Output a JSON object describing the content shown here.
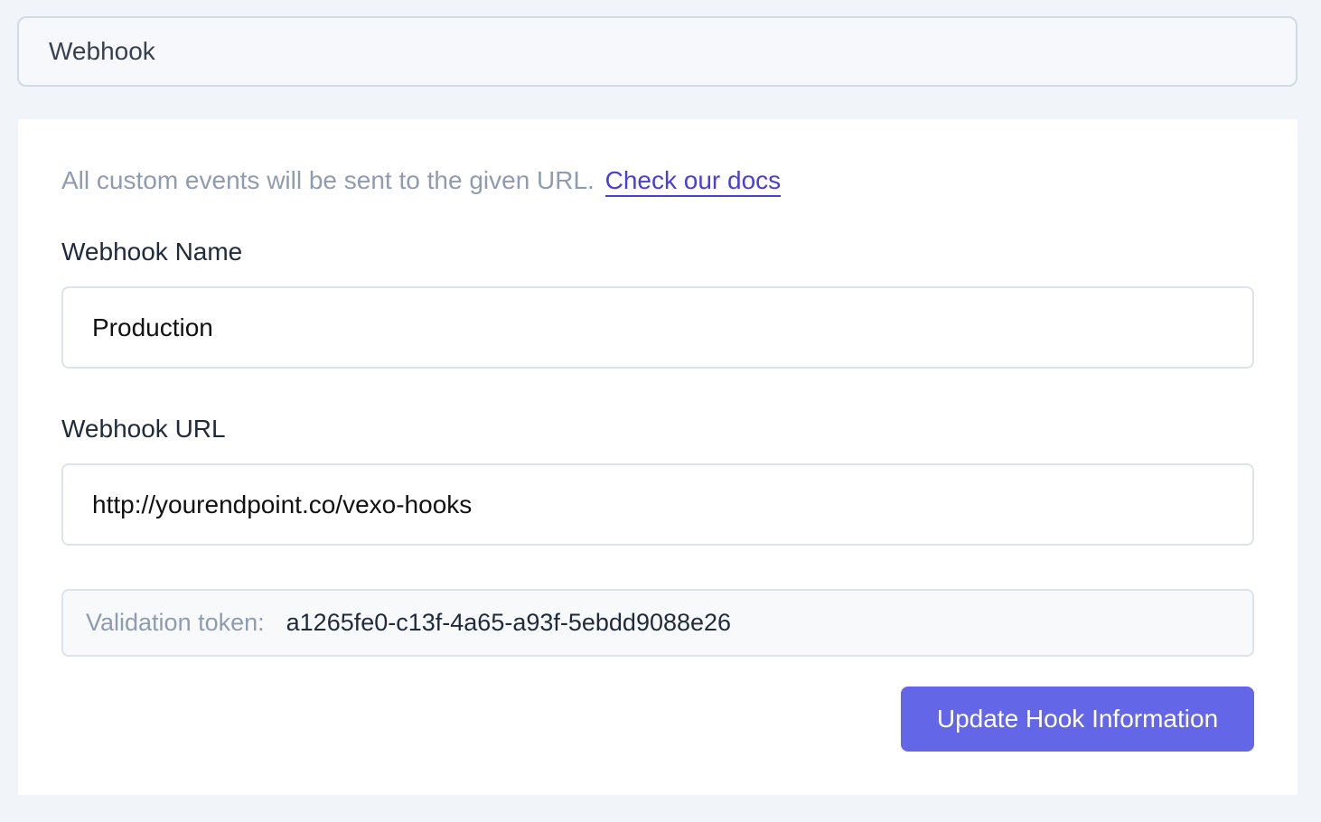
{
  "header": {
    "title": "Webhook"
  },
  "card": {
    "description": "All custom events will be sent to the given URL.",
    "docs_link": "Check our docs",
    "name_field": {
      "label": "Webhook Name",
      "value": "Production"
    },
    "url_field": {
      "label": "Webhook URL",
      "value": "http://yourendpoint.co/vexo-hooks"
    },
    "token": {
      "label": "Validation token:",
      "value": "a1265fe0-c13f-4a65-a93f-5ebdd9088e26"
    },
    "submit_label": "Update Hook Information"
  },
  "colors": {
    "accent": "#6366e6",
    "link": "#4a3fd6",
    "background": "#f1f4f8"
  }
}
